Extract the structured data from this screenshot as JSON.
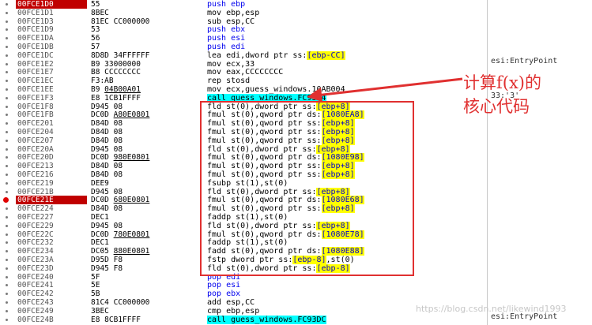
{
  "rows": [
    {
      "addr": "00FCE1D0",
      "bytes": "55",
      "mn": [
        [
          "kw-push",
          "push ebp"
        ]
      ],
      "hl": true,
      "bp": false
    },
    {
      "addr": "00FCE1D1",
      "bytes": "8BEC",
      "mn": [
        [
          "plain",
          "mov ebp,esp"
        ]
      ]
    },
    {
      "addr": "00FCE1D3",
      "bytes": "81EC CC000000",
      "mn": [
        [
          "plain",
          "sub esp,CC"
        ]
      ]
    },
    {
      "addr": "00FCE1D9",
      "bytes": "53",
      "mn": [
        [
          "kw-push",
          "push ebx"
        ]
      ]
    },
    {
      "addr": "00FCE1DA",
      "bytes": "56",
      "mn": [
        [
          "kw-push",
          "push esi"
        ]
      ]
    },
    {
      "addr": "00FCE1DB",
      "bytes": "57",
      "mn": [
        [
          "kw-push",
          "push edi"
        ]
      ]
    },
    {
      "addr": "00FCE1DC",
      "bytes": "8D8D 34FFFFFF",
      "mn": [
        [
          "plain",
          "lea edi,dword ptr ss:"
        ],
        [
          "y",
          "[ebp-CC]"
        ]
      ]
    },
    {
      "addr": "00FCE1E2",
      "bytes": "B9 33000000",
      "mn": [
        [
          "plain",
          "mov ecx,33"
        ]
      ]
    },
    {
      "addr": "00FCE1E7",
      "bytes": "B8 CCCCCCCC",
      "mn": [
        [
          "plain",
          "mov eax,CCCCCCCC"
        ]
      ]
    },
    {
      "addr": "00FCE1EC",
      "bytes": "F3:AB",
      "mn": [
        [
          "plain",
          "rep stosd"
        ]
      ]
    },
    {
      "addr": "00FCE1EE",
      "bytes": "B9 04B00A01",
      "mn": [
        [
          "plain",
          "mov ecx,guess_windows.10AB004"
        ]
      ],
      "u": "04B00A01"
    },
    {
      "addr": "00FCE1F3",
      "bytes": "E8 1CB1FFFF",
      "mn": [
        [
          "kw-call",
          "call guess_windows.FC9314"
        ]
      ]
    },
    {
      "addr": "00FCE1F8",
      "bytes": "D945 08",
      "mn": [
        [
          "plain",
          "fld st(0),dword ptr ss:"
        ],
        [
          "y",
          "[ebp+8]"
        ]
      ]
    },
    {
      "addr": "00FCE1FB",
      "bytes": "DC0D A80E0801",
      "mn": [
        [
          "plain",
          "fmul st(0),qword ptr ds:"
        ],
        [
          "y",
          "[1080EA8]"
        ]
      ],
      "u": "A80E0801"
    },
    {
      "addr": "00FCE201",
      "bytes": "D84D 08",
      "mn": [
        [
          "plain",
          "fmul st(0),qword ptr ss:"
        ],
        [
          "y",
          "[ebp+8]"
        ]
      ]
    },
    {
      "addr": "00FCE204",
      "bytes": "D84D 08",
      "mn": [
        [
          "plain",
          "fmul st(0),qword ptr ss:"
        ],
        [
          "y",
          "[ebp+8]"
        ]
      ]
    },
    {
      "addr": "00FCE207",
      "bytes": "D84D 08",
      "mn": [
        [
          "plain",
          "fmul st(0),qword ptr ss:"
        ],
        [
          "y",
          "[ebp+8]"
        ]
      ]
    },
    {
      "addr": "00FCE20A",
      "bytes": "D945 08",
      "mn": [
        [
          "plain",
          "fld st(0),dword ptr ss:"
        ],
        [
          "y",
          "[ebp+8]"
        ]
      ]
    },
    {
      "addr": "00FCE20D",
      "bytes": "DC0D 980E0801",
      "mn": [
        [
          "plain",
          "fmul st(0),qword ptr ds:"
        ],
        [
          "y",
          "[1080E98]"
        ]
      ],
      "u": "980E0801"
    },
    {
      "addr": "00FCE213",
      "bytes": "D84D 08",
      "mn": [
        [
          "plain",
          "fmul st(0),qword ptr ss:"
        ],
        [
          "y",
          "[ebp+8]"
        ]
      ]
    },
    {
      "addr": "00FCE216",
      "bytes": "D84D 08",
      "mn": [
        [
          "plain",
          "fmul st(0),qword ptr ss:"
        ],
        [
          "y",
          "[ebp+8]"
        ]
      ]
    },
    {
      "addr": "00FCE219",
      "bytes": "DEE9",
      "mn": [
        [
          "plain",
          "fsubp st(1),st(0)"
        ]
      ]
    },
    {
      "addr": "00FCE21B",
      "bytes": "D945 08",
      "mn": [
        [
          "plain",
          "fld st(0),dword ptr ss:"
        ],
        [
          "y",
          "[ebp+8]"
        ]
      ]
    },
    {
      "addr": "00FCE21E",
      "bytes": "DC0D 680E0801",
      "mn": [
        [
          "plain",
          "fmul st(0),qword ptr ds:"
        ],
        [
          "y",
          "[1080E68]"
        ]
      ],
      "hl": true,
      "bp": true,
      "u": "680E0801"
    },
    {
      "addr": "00FCE224",
      "bytes": "D84D 08",
      "mn": [
        [
          "plain",
          "fmul st(0),qword ptr ss:"
        ],
        [
          "y",
          "[ebp+8]"
        ]
      ]
    },
    {
      "addr": "00FCE227",
      "bytes": "DEC1",
      "mn": [
        [
          "plain",
          "faddp st(1),st(0)"
        ]
      ]
    },
    {
      "addr": "00FCE229",
      "bytes": "D945 08",
      "mn": [
        [
          "plain",
          "fld st(0),dword ptr ss:"
        ],
        [
          "y",
          "[ebp+8]"
        ]
      ]
    },
    {
      "addr": "00FCE22C",
      "bytes": "DC0D 780E0801",
      "mn": [
        [
          "plain",
          "fmul st(0),qword ptr ds:"
        ],
        [
          "y",
          "[1080E78]"
        ]
      ],
      "u": "780E0801"
    },
    {
      "addr": "00FCE232",
      "bytes": "DEC1",
      "mn": [
        [
          "plain",
          "faddp st(1),st(0)"
        ]
      ]
    },
    {
      "addr": "00FCE234",
      "bytes": "DC05 880E0801",
      "mn": [
        [
          "plain",
          "fadd st(0),qword ptr ds:"
        ],
        [
          "y",
          "[1080E88]"
        ]
      ],
      "u": "880E0801"
    },
    {
      "addr": "00FCE23A",
      "bytes": "D95D F8",
      "mn": [
        [
          "plain",
          "fstp dword ptr ss:"
        ],
        [
          "y",
          "[ebp-8]"
        ],
        [
          "plain",
          ",st(0)"
        ]
      ]
    },
    {
      "addr": "00FCE23D",
      "bytes": "D945 F8",
      "mn": [
        [
          "plain",
          "fld st(0),dword ptr ss:"
        ],
        [
          "y",
          "[ebp-8]"
        ]
      ]
    },
    {
      "addr": "00FCE240",
      "bytes": "5F",
      "mn": [
        [
          "kw-push",
          "pop edi"
        ]
      ]
    },
    {
      "addr": "00FCE241",
      "bytes": "5E",
      "mn": [
        [
          "kw-push",
          "pop esi"
        ]
      ]
    },
    {
      "addr": "00FCE242",
      "bytes": "5B",
      "mn": [
        [
          "kw-push",
          "pop ebx"
        ]
      ]
    },
    {
      "addr": "00FCE243",
      "bytes": "81C4 CC000000",
      "mn": [
        [
          "plain",
          "add esp,CC"
        ]
      ]
    },
    {
      "addr": "00FCE249",
      "bytes": "3BEC",
      "mn": [
        [
          "plain",
          "cmp ebp,esp"
        ]
      ]
    },
    {
      "addr": "00FCE24B",
      "bytes": "E8 8CB1FFFF",
      "mn": [
        [
          "kw-call",
          "call guess_windows.FC93DC"
        ]
      ]
    }
  ],
  "comments": [
    {
      "row": 3,
      "text": "esi:EntryPoint"
    },
    {
      "row": 7,
      "text": "33:'3'"
    },
    {
      "row": 33,
      "text": "esi:EntryPoint"
    }
  ],
  "annotation": {
    "line1": "计算f(x)的",
    "line2": "核心代码"
  },
  "watermark": "https://blog.csdn.net/likewind1993",
  "colors": {
    "highlight": "#c00000",
    "annotation": "#e03030",
    "operand_bg": "#ffff00",
    "call_bg": "#00ffff"
  }
}
